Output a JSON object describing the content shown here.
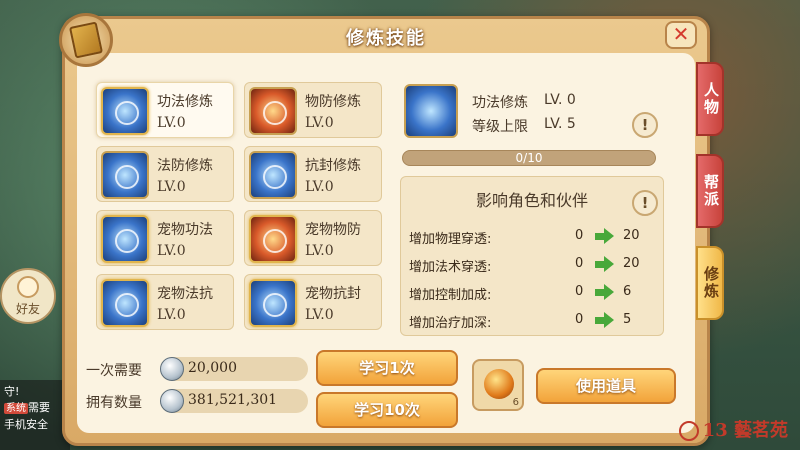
{
  "window": {
    "title": "修炼技能"
  },
  "skills": [
    {
      "name": "功法修炼",
      "level": "LV.0",
      "icon": "blue-orb-icon",
      "selected": true
    },
    {
      "name": "物防修炼",
      "level": "LV.0",
      "icon": "red-beast-icon"
    },
    {
      "name": "法防修炼",
      "level": "LV.0",
      "icon": "blue-shield-icon"
    },
    {
      "name": "抗封修炼",
      "level": "LV.0",
      "icon": "blue-seal-icon"
    },
    {
      "name": "宠物功法",
      "level": "LV.0",
      "icon": "pet-blue-flame-icon"
    },
    {
      "name": "宠物物防",
      "level": "LV.0",
      "icon": "pet-red-flame-icon"
    },
    {
      "name": "宠物法抗",
      "level": "LV.0",
      "icon": "pet-blue-star-icon"
    },
    {
      "name": "宠物抗封",
      "level": "LV.0",
      "icon": "pet-blue-sphere-icon"
    }
  ],
  "detail": {
    "name": "功法修炼",
    "level": "LV. 0",
    "cap_label": "等级上限",
    "cap_value": "LV. 5",
    "progress_text": "0/10",
    "progress_fraction": 0
  },
  "effects": {
    "title": "影响角色和伙伴",
    "rows": [
      {
        "label": "增加物理穿透:",
        "from": "0",
        "to": "20"
      },
      {
        "label": "增加法术穿透:",
        "from": "0",
        "to": "20"
      },
      {
        "label": "增加控制加成:",
        "from": "0",
        "to": "6"
      },
      {
        "label": "增加治疗加深:",
        "from": "0",
        "to": "5"
      }
    ]
  },
  "costs": {
    "need_label": "一次需要",
    "need_value": "20,000",
    "own_label": "拥有数量",
    "own_value": "381,521,301"
  },
  "buttons": {
    "learn_once": "学习1次",
    "learn_ten": "学习10次",
    "use_item": "使用道具"
  },
  "item": {
    "count": "6",
    "icon": "treasure-chest-icon"
  },
  "side_tabs": [
    {
      "label": "人物",
      "color": "#c8433b"
    },
    {
      "label": "帮派",
      "color": "#c8433b"
    },
    {
      "label": "修炼",
      "color": "#f0b848"
    }
  ],
  "background": {
    "friend_label": "好友",
    "chat": {
      "line1": "守!",
      "tag": "系统",
      "line2": "需要",
      "line3": "手机安全"
    }
  },
  "watermark": {
    "text": "13 藝茗苑"
  }
}
